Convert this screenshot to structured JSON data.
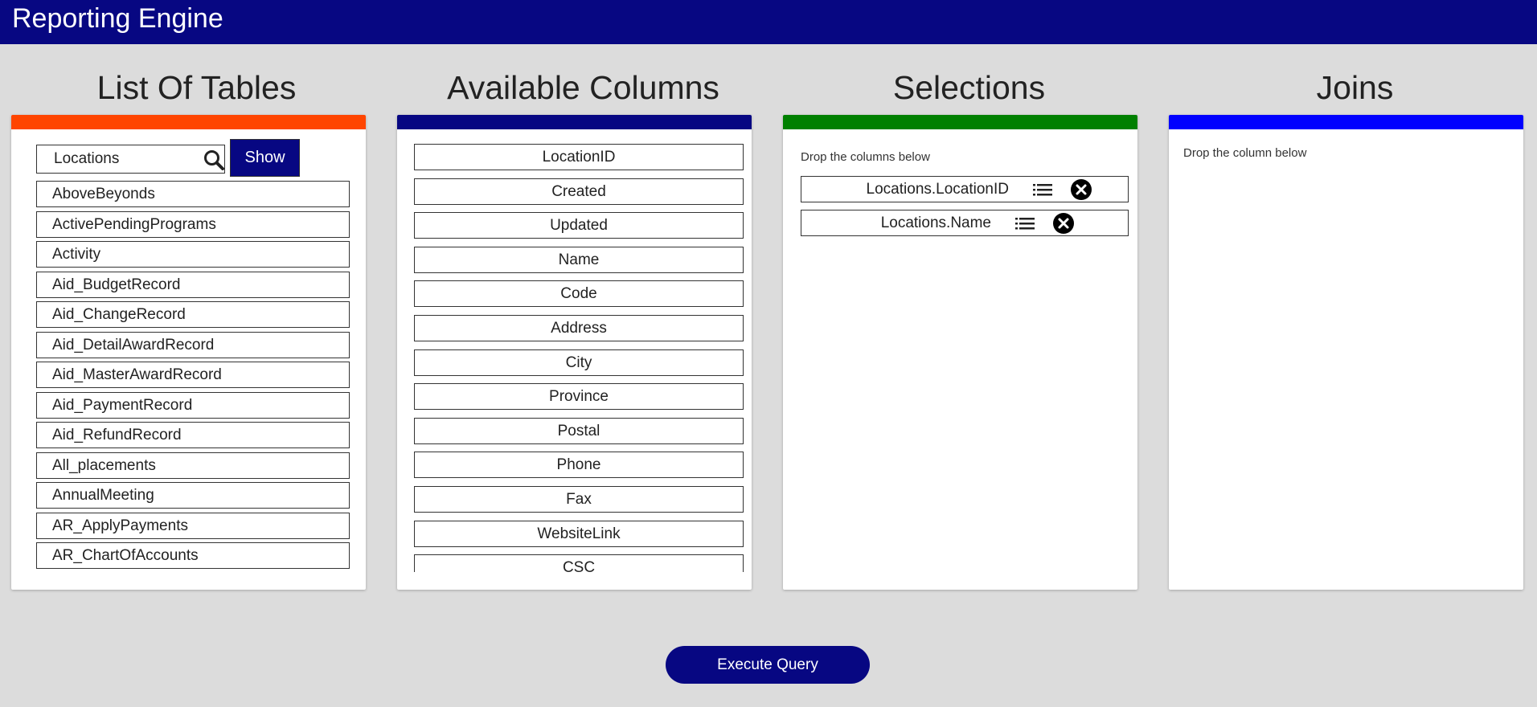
{
  "app": {
    "title": "Reporting Engine"
  },
  "colors": {
    "header": "#070782",
    "tables_accent": "#ff4500",
    "columns_accent": "#070782",
    "selections_accent": "#008000",
    "joins_accent": "#0000ff"
  },
  "tables_panel": {
    "title": "List Of Tables",
    "search_value": "Locations",
    "search_icon": "search-icon",
    "show_label": "Show",
    "items": [
      "AboveBeyonds",
      "ActivePendingPrograms",
      "Activity",
      "Aid_BudgetRecord",
      "Aid_ChangeRecord",
      "Aid_DetailAwardRecord",
      "Aid_MasterAwardRecord",
      "Aid_PaymentRecord",
      "Aid_RefundRecord",
      "All_placements",
      "AnnualMeeting",
      "AR_ApplyPayments",
      "AR_ChartOfAccounts"
    ]
  },
  "columns_panel": {
    "title": "Available Columns",
    "items": [
      "LocationID",
      "Created",
      "Updated",
      "Name",
      "Code",
      "Address",
      "City",
      "Province",
      "Postal",
      "Phone",
      "Fax",
      "WebsiteLink",
      "CSC"
    ]
  },
  "selections_panel": {
    "title": "Selections",
    "hint": "Drop the columns below",
    "items": [
      {
        "label": "Locations.LocationID",
        "menu_icon": "list-icon",
        "remove_icon": "close-icon"
      },
      {
        "label": "Locations.Name",
        "menu_icon": "list-icon",
        "remove_icon": "close-icon"
      }
    ]
  },
  "joins_panel": {
    "title": "Joins",
    "hint": "Drop the column below"
  },
  "execute_label": "Execute Query"
}
